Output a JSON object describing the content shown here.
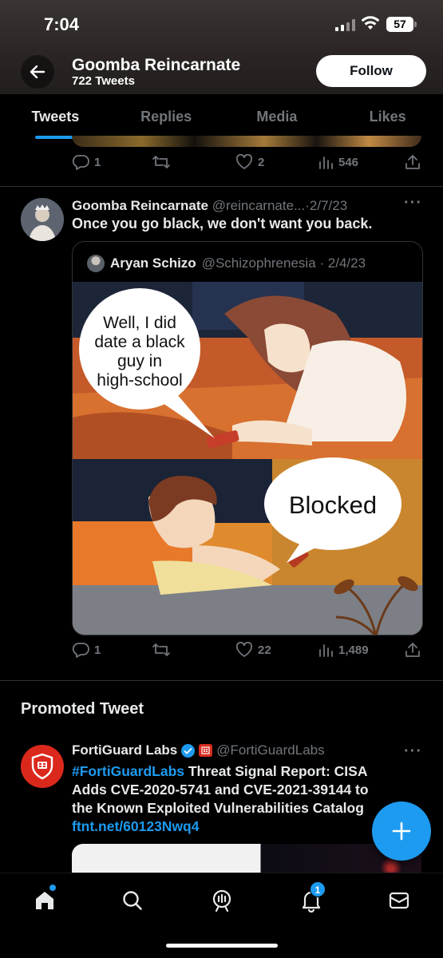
{
  "status_bar": {
    "time": "7:04",
    "battery": "57"
  },
  "profile_header": {
    "name": "Goomba Reincarnate",
    "tweet_count": "722 Tweets",
    "follow_label": "Follow"
  },
  "tabs": [
    {
      "label": "Tweets",
      "active": true
    },
    {
      "label": "Replies",
      "active": false
    },
    {
      "label": "Media",
      "active": false
    },
    {
      "label": "Likes",
      "active": false
    }
  ],
  "prev_tweet": {
    "replies": "1",
    "likes": "2",
    "views": "546"
  },
  "tweet": {
    "name": "Goomba Reincarnate",
    "handle": "@reincarnate...",
    "date": "2/7/23",
    "text": "Once you go black, we don't want you back.",
    "quote": {
      "name": "Aryan Schizo",
      "handle": "@Schizophrenesia",
      "date": "2/4/23",
      "bubble_top": [
        "Well, I did",
        "date a black",
        "guy in",
        "high-school"
      ],
      "bubble_bottom": "Blocked"
    },
    "replies": "1",
    "likes": "22",
    "views": "1,489"
  },
  "promoted": {
    "label": "Promoted Tweet",
    "name": "FortiGuard Labs",
    "handle": "@FortiGuardLabs",
    "hashtag": "#FortiGuardLabs",
    "line1_rest": " Threat Signal Report: CISA",
    "line2": "Adds CVE-2020-5741 and CVE-2021-39144 to",
    "line3": "the Known Exploited Vulnerabilities Catalog",
    "link": "ftnt.net/60123Nwq4"
  },
  "bottom_nav": {
    "notifications_badge": "1"
  },
  "colors": {
    "accent": "#1d9bf0",
    "muted": "#71767b",
    "brand_red": "#da291c"
  }
}
